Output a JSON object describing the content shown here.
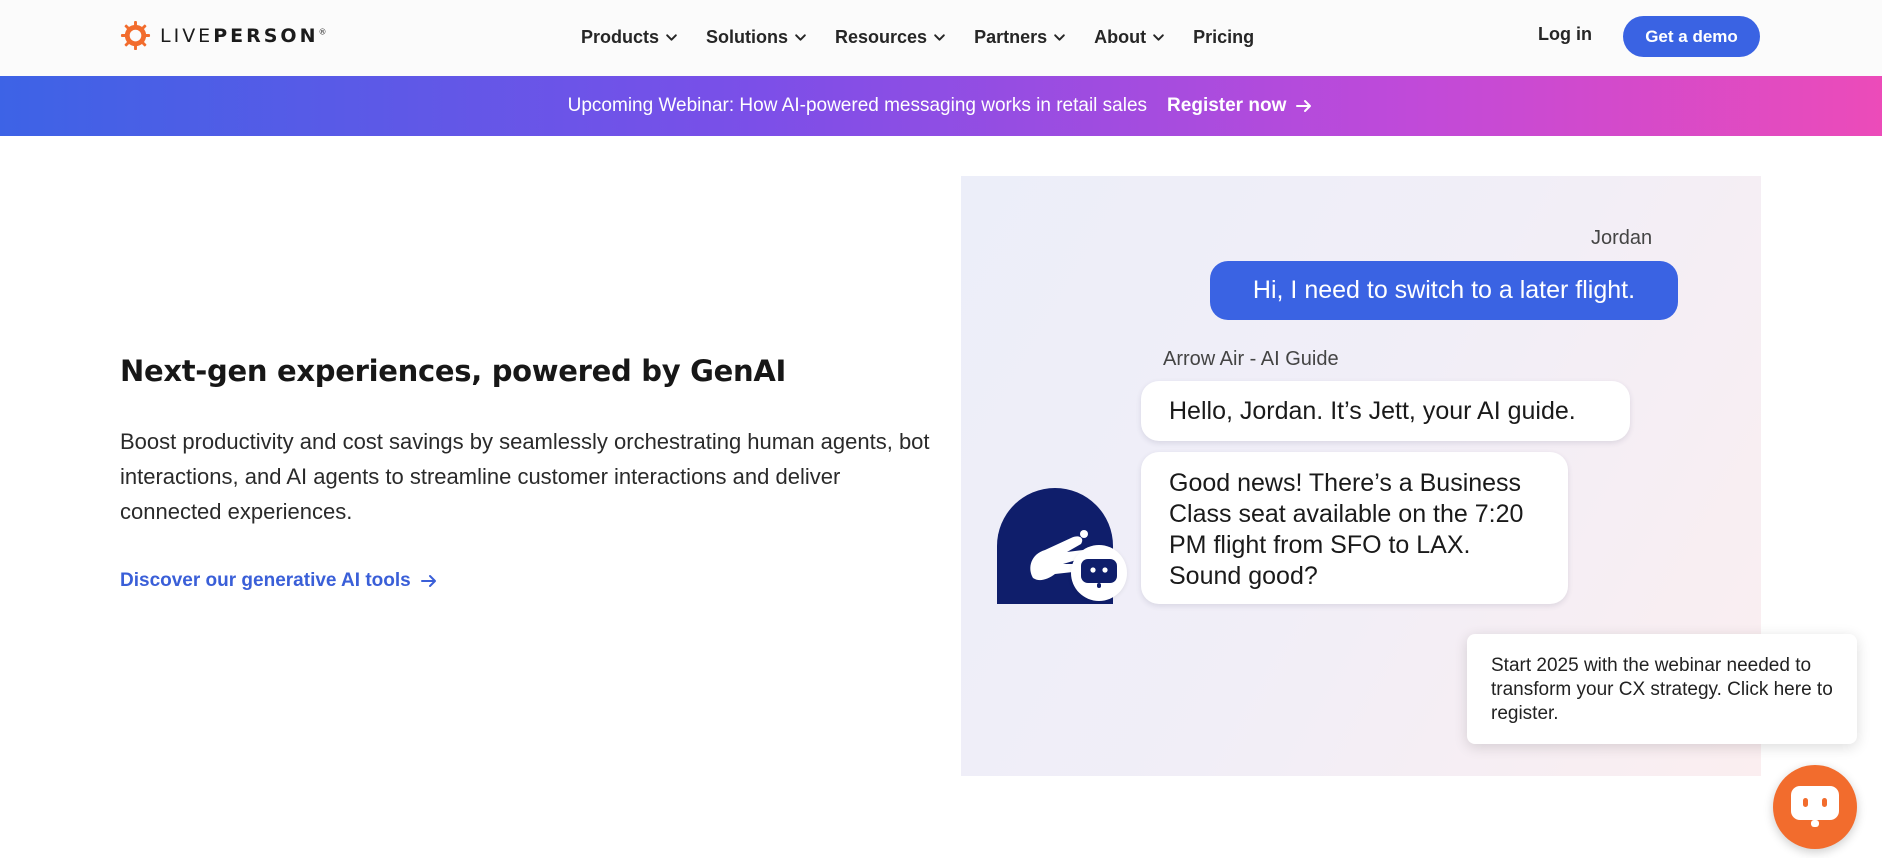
{
  "header": {
    "logo": {
      "text_light": "LIVE",
      "text_bold": "PERSON",
      "registered": "®"
    },
    "nav": [
      {
        "label": "Products"
      },
      {
        "label": "Solutions"
      },
      {
        "label": "Resources"
      },
      {
        "label": "Partners"
      },
      {
        "label": "About"
      },
      {
        "label": "Pricing"
      }
    ],
    "login_label": "Log in",
    "demo_label": "Get a demo"
  },
  "banner": {
    "text": "Upcoming Webinar: How AI-powered messaging works in retail sales",
    "link_label": "Register now"
  },
  "main": {
    "headline": "Next-gen experiences, powered by GenAI",
    "body": "Boost productivity and cost savings by seamlessly orchestrating human agents, bot interactions, and AI agents to streamline customer interactions and deliver connected experiences.",
    "link_label": "Discover our generative AI tools"
  },
  "chat": {
    "user_name": "Jordan",
    "user_message": "Hi, I need to switch to a later flight.",
    "agent_name": "Arrow Air - AI Guide",
    "bot_message_1": "Hello, Jordan. It’s Jett, your AI guide.",
    "bot_message_2": "Good news! There’s a Business Class seat available on the 7:20 PM flight from SFO to LAX. Sound good?"
  },
  "toast": {
    "text": "Start 2025 with the webinar needed to transform your CX strategy. Click here to register."
  },
  "colors": {
    "brand_blue": "#3a63e3",
    "logo_orange": "#f26c2d",
    "avatar_navy": "#0f1e6b"
  },
  "icons": {
    "logo": "sun-gear-icon",
    "nav_chevron": "chevron-down-icon",
    "arrow": "arrow-right-icon",
    "avatar": "winged-arrow-icon",
    "bot": "robot-icon",
    "launcher": "chat-bubble-icon"
  }
}
